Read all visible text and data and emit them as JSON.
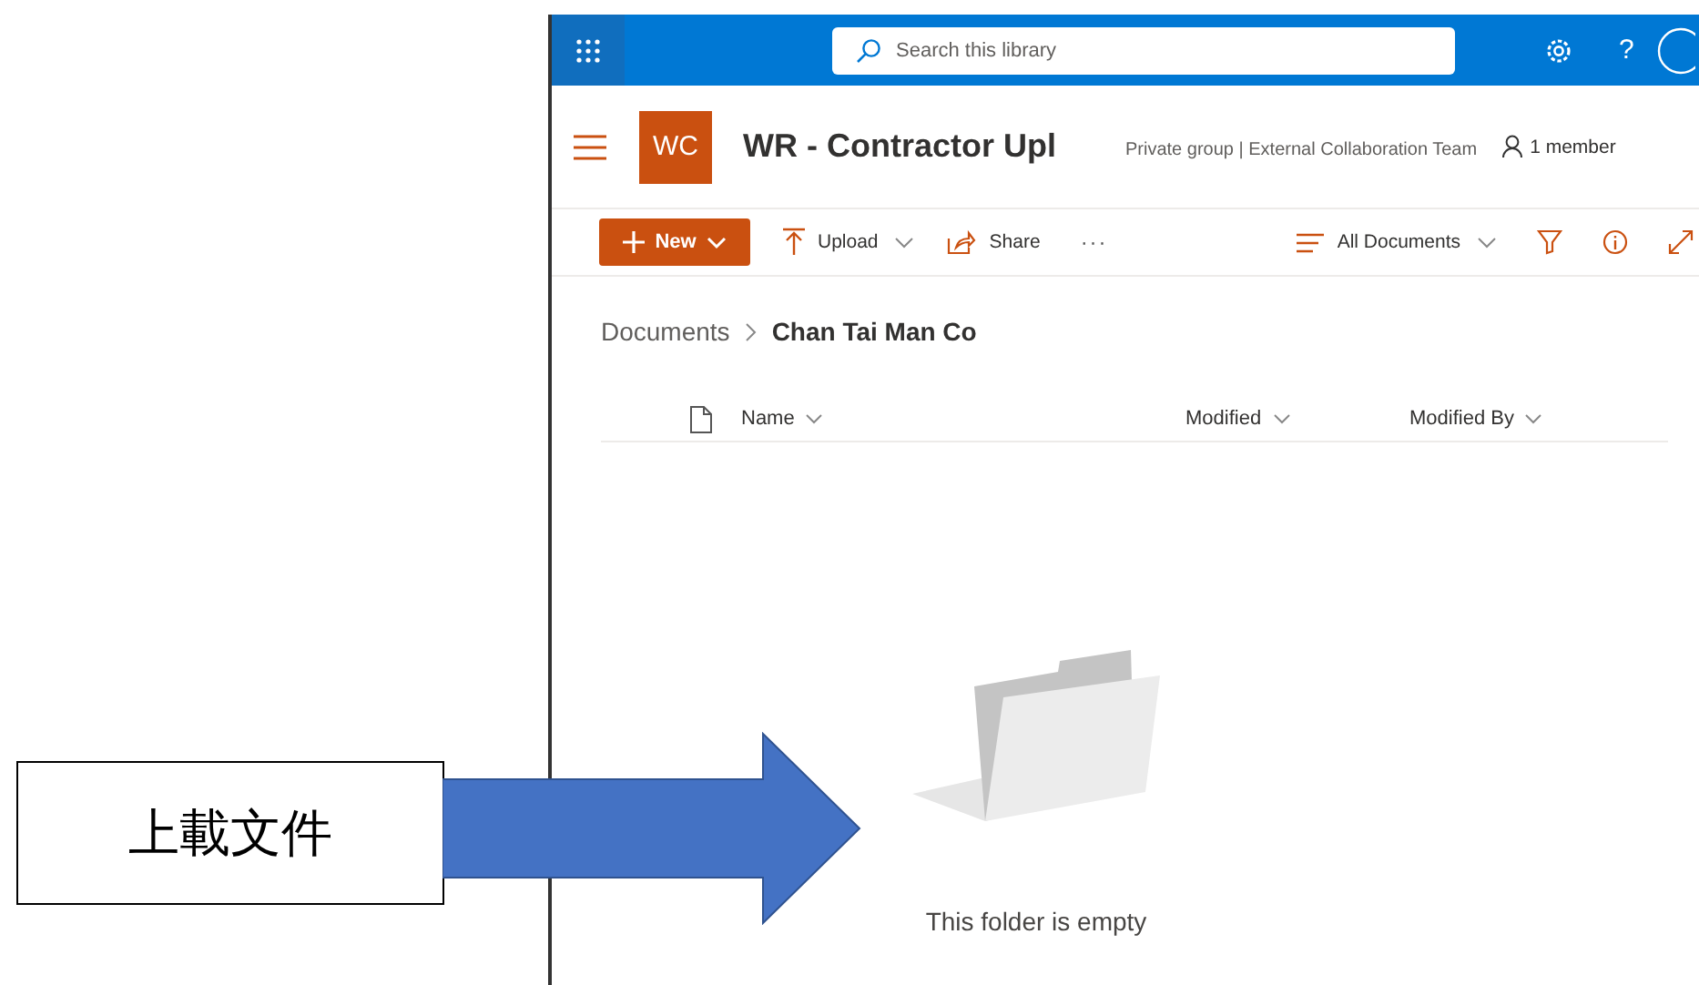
{
  "top_bar": {
    "search": {
      "placeholder": "Search this library"
    },
    "help": "?"
  },
  "site": {
    "logo": "WC",
    "title": "WR - Contractor Upl",
    "group_info": "Private group | External Collaboration Team",
    "members": "1 member"
  },
  "command_bar": {
    "new": "New",
    "actions": [
      {
        "label": "Upload",
        "kind": "upload",
        "dropdown": true
      },
      {
        "label": "Share",
        "kind": "share",
        "dropdown": false
      }
    ],
    "more": "···",
    "view": "All Documents"
  },
  "breadcrumb": [
    {
      "label": "Documents",
      "current": false
    },
    {
      "label": "Chan Tai Man Co",
      "current": true
    }
  ],
  "columns": [
    {
      "label": "Name"
    },
    {
      "label": "Modified"
    },
    {
      "label": "Modified By"
    }
  ],
  "empty_message": "This folder is empty",
  "callout": {
    "label": "上載文件"
  }
}
